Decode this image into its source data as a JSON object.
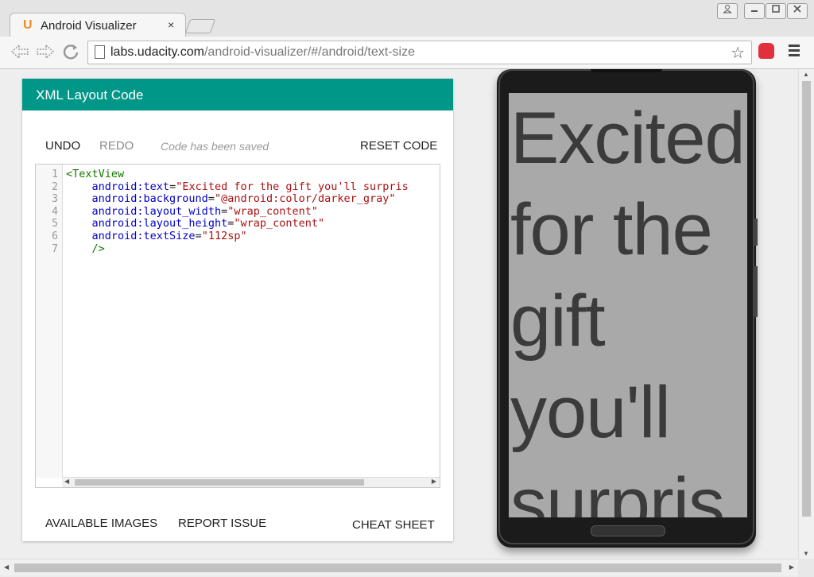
{
  "browser": {
    "tab_title": "Android Visualizer",
    "tab_favicon": "U",
    "tab_close": "×",
    "url_host": "labs.udacity.com",
    "url_path": "/android-visualizer/#/android/text-size",
    "icons": [
      "back-icon",
      "forward-icon",
      "reload-icon",
      "page-icon",
      "star-icon",
      "extension-icon",
      "menu-icon",
      "profile-icon",
      "minimize-icon",
      "maximize-icon",
      "close-window-icon"
    ]
  },
  "editor_card": {
    "title": "XML Layout Code",
    "undo": "UNDO",
    "redo": "REDO",
    "saved_status": "Code has been saved",
    "reset": "RESET CODE",
    "available_images": "AVAILABLE IMAGES",
    "report_issue": "REPORT ISSUE",
    "cheat_sheet": "CHEAT SHEET",
    "accent_color": "#009688"
  },
  "code": {
    "line_numbers": [
      "1",
      "2",
      "3",
      "4",
      "5",
      "6",
      "7"
    ],
    "l1_tag": "<TextView",
    "l2_attr": "android:text",
    "l2_val": "\"Excited for the gift you'll surpris",
    "l3_attr": "android:background",
    "l3_val": "\"@android:color/darker_gray\"",
    "l4_attr": "android:layout_width",
    "l4_val": "\"wrap_content\"",
    "l5_attr": "android:layout_height",
    "l5_val": "\"wrap_content\"",
    "l6_attr": "android:textSize",
    "l6_val": "\"112sp\"",
    "l7_tag": "/>",
    "equals": "="
  },
  "preview": {
    "text": "Excited for the gift you'll surpris",
    "background_color": "#a9a9a9"
  }
}
